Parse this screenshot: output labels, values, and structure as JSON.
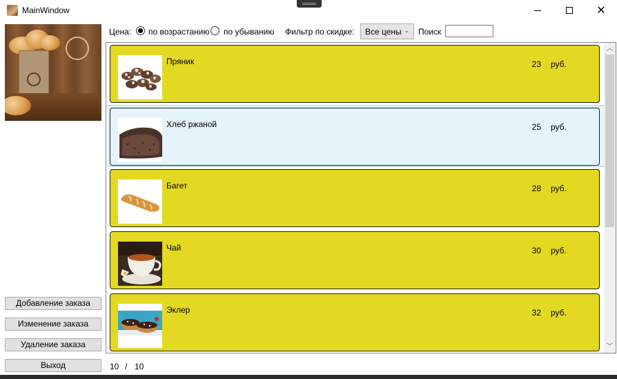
{
  "window": {
    "title": "MainWindow"
  },
  "controls": {
    "minimize": "minimize",
    "maximize": "maximize",
    "close": "✕"
  },
  "toolbar": {
    "price_label": "Цена:",
    "sort_asc_label": "по возрастанию",
    "sort_desc_label": "по убыванию",
    "sort_selected": "asc",
    "discount_label": "Фильтр по скидке:",
    "discount_selected": "Все цены",
    "search_label": "Поиск",
    "search_value": ""
  },
  "sidebar": {
    "buttons": [
      "Добавление заказа",
      "Изменение заказа",
      "Удаление заказа",
      "Выход"
    ]
  },
  "products": [
    {
      "name": "Пряник",
      "price": "23",
      "currency": "руб.",
      "image": "gingerbread-image",
      "selected": false
    },
    {
      "name": "Хлеб ржаной",
      "price": "25",
      "currency": "руб.",
      "image": "rye-bread-image",
      "selected": true
    },
    {
      "name": "Багет",
      "price": "28",
      "currency": "руб.",
      "image": "baguette-image",
      "selected": false
    },
    {
      "name": "Чай",
      "price": "30",
      "currency": "руб.",
      "image": "tea-cup-image",
      "selected": false
    },
    {
      "name": "Эклер",
      "price": "32",
      "currency": "руб.",
      "image": "eclair-image",
      "selected": false
    }
  ],
  "pager": {
    "shown": "10",
    "separator": "/",
    "total": "10"
  },
  "colors": {
    "card": "#e3d923",
    "selected_card": "#e5f3fb",
    "border": "#1f1f1f"
  }
}
